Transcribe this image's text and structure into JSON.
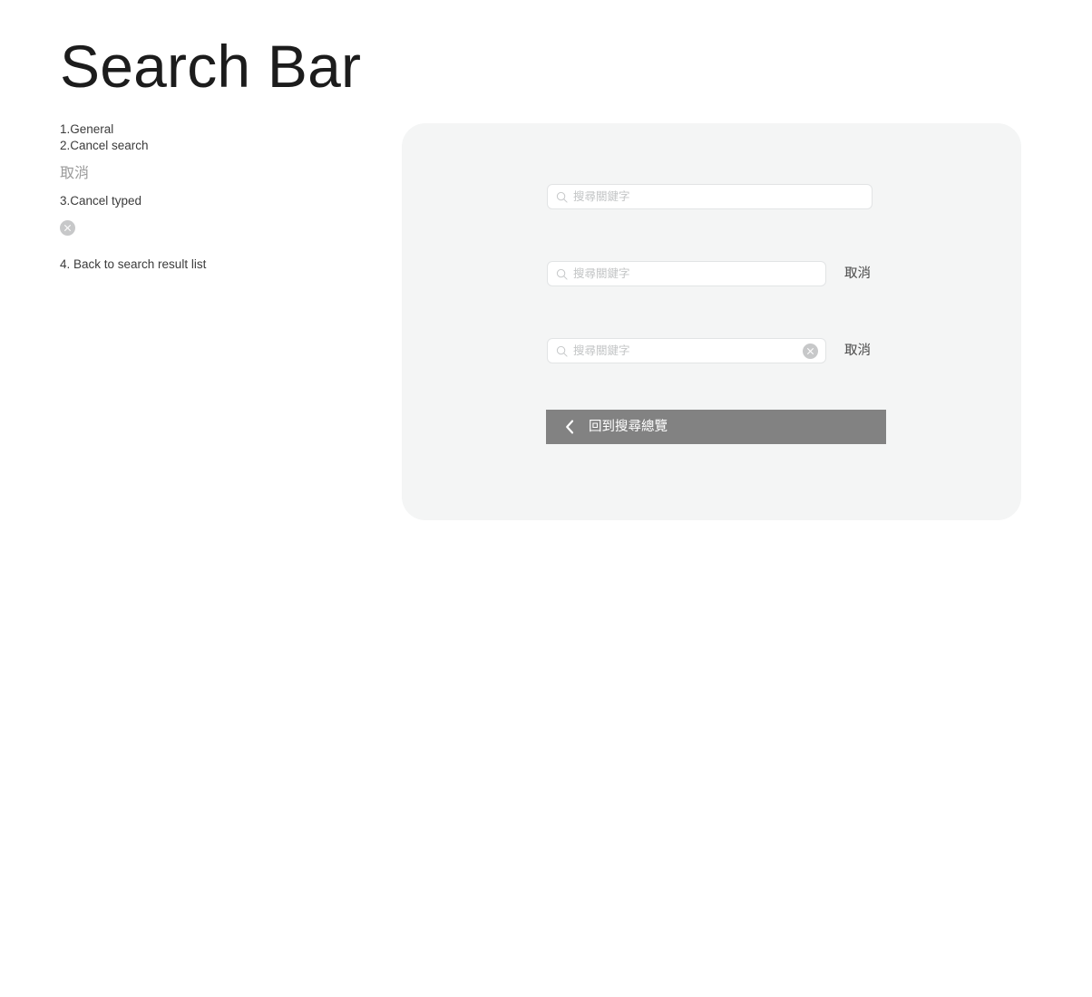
{
  "page": {
    "title": "Search Bar"
  },
  "annotations": {
    "items": [
      {
        "label": "1.General"
      },
      {
        "label": "2.Cancel search"
      },
      {
        "label": "取消"
      },
      {
        "label": "3.Cancel typed"
      },
      {
        "label": "clear-icon"
      },
      {
        "label": "4. Back to search result list"
      }
    ]
  },
  "preview": {
    "rows": [
      {
        "search_icon": "search-icon",
        "placeholder": "搜尋關鍵字",
        "value": "",
        "has_clear": false,
        "cancel_label": ""
      },
      {
        "search_icon": "search-icon",
        "placeholder": "搜尋關鍵字",
        "value": "",
        "has_clear": false,
        "cancel_label": "取消"
      },
      {
        "search_icon": "search-icon",
        "placeholder": "搜尋關鍵字",
        "value": "",
        "has_clear": true,
        "clear_icon": "clear-icon",
        "cancel_label": "取消"
      }
    ],
    "back_bar": {
      "icon": "chevron-left-icon",
      "label": "回到搜尋總覽"
    }
  },
  "colors": {
    "panel_background": "#f4f5f5",
    "field_background": "#ffffff",
    "field_border": "#e2e4e5",
    "placeholder_text": "#c3c5c6",
    "clear_icon_fill": "#c7c8c9",
    "cancel_text": "#464646",
    "back_bar_background": "#828282",
    "back_bar_text": "#ffffff",
    "title_text": "#1c1c1c",
    "annotation_text": "#3b3b3b",
    "annotation_muted_text": "#9b9b9b"
  }
}
